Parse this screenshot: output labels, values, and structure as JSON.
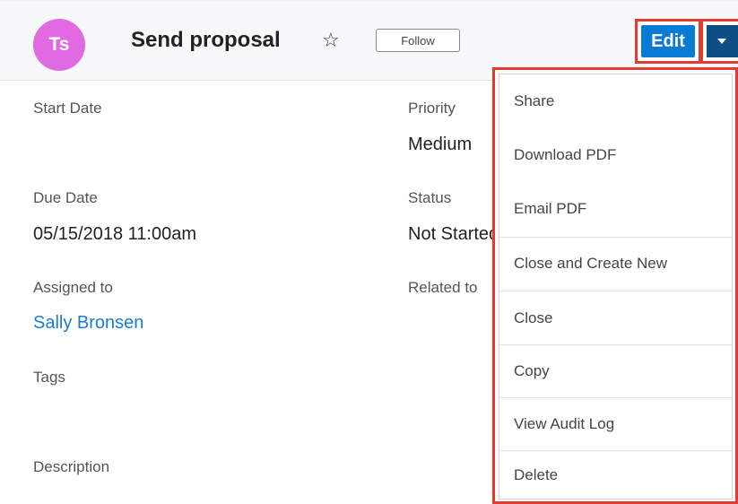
{
  "record": {
    "avatar_initials": "Ts",
    "title": "Send proposal",
    "star_glyph": "☆",
    "follow_label": "Follow",
    "edit_label": "Edit"
  },
  "fields": {
    "start_date": {
      "label": "Start Date",
      "value": ""
    },
    "priority": {
      "label": "Priority",
      "value": "Medium"
    },
    "due_date": {
      "label": "Due Date",
      "value": "05/15/2018 11:00am"
    },
    "status": {
      "label": "Status",
      "value": "Not Started"
    },
    "assigned_to": {
      "label": "Assigned to",
      "value": "Sally Bronsen"
    },
    "related_to": {
      "label": "Related to",
      "value": ""
    },
    "tags": {
      "label": "Tags",
      "value": ""
    },
    "description": {
      "label": "Description",
      "value": ""
    }
  },
  "actions_menu": {
    "items": [
      {
        "label": "Share"
      },
      {
        "label": "Download PDF"
      },
      {
        "label": "Email PDF"
      },
      {
        "label": "Close and Create New"
      },
      {
        "label": "Close"
      },
      {
        "label": "Copy"
      },
      {
        "label": "View Audit Log"
      },
      {
        "label": "Delete"
      }
    ]
  },
  "colors": {
    "avatar": "#e16ae2",
    "primary": "#0a7bd3",
    "dropdown": "#0d4f85",
    "highlight": "#e43a2f",
    "link": "#1a7dd0"
  },
  "icons": {
    "favorite": "star-outline-icon",
    "actions": "caret-down-icon"
  }
}
